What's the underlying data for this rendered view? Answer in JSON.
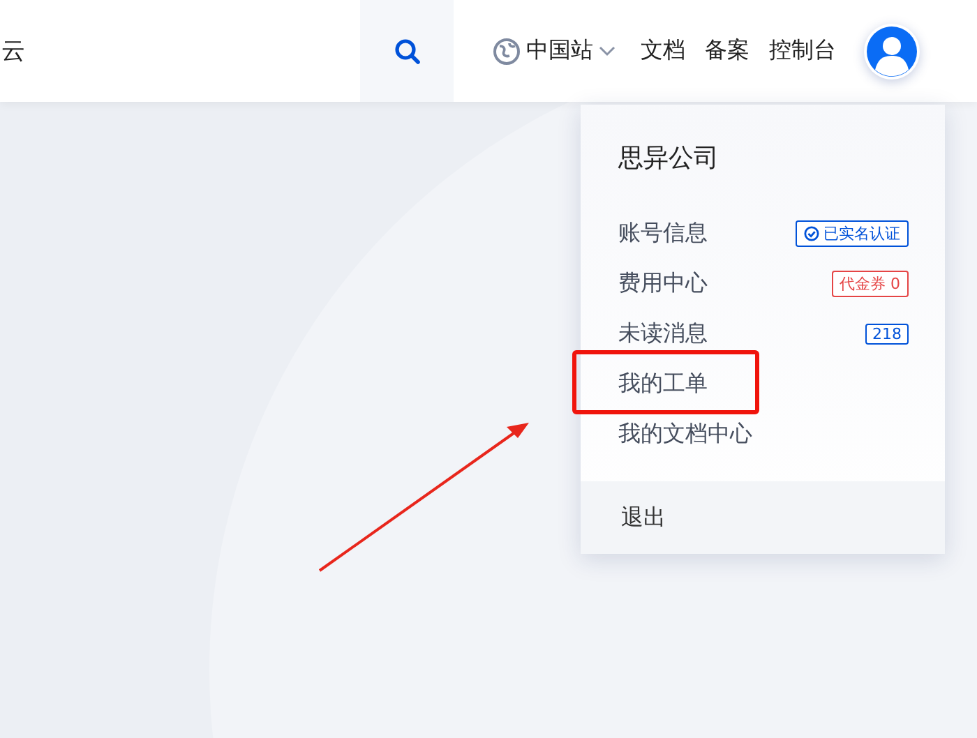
{
  "header": {
    "brand_fragment": "云",
    "nav": [
      {
        "label": "中国站",
        "kind": "region"
      },
      {
        "label": "文档",
        "kind": "link"
      },
      {
        "label": "备案",
        "kind": "link"
      },
      {
        "label": "控制台",
        "kind": "link"
      }
    ]
  },
  "dropdown": {
    "title": "思异公司",
    "items": [
      {
        "label": "账号信息",
        "highlighted": false,
        "badge": {
          "kind": "verified",
          "text": "已实名认证"
        }
      },
      {
        "label": "费用中心",
        "highlighted": false,
        "badge": {
          "kind": "coupon",
          "text": "代金券 0"
        }
      },
      {
        "label": "未读消息",
        "highlighted": false,
        "badge": {
          "kind": "message",
          "text": "218"
        }
      },
      {
        "label": "我的工单",
        "highlighted": true
      },
      {
        "label": "我的文档中心",
        "highlighted": false
      }
    ],
    "logout": "退出"
  }
}
